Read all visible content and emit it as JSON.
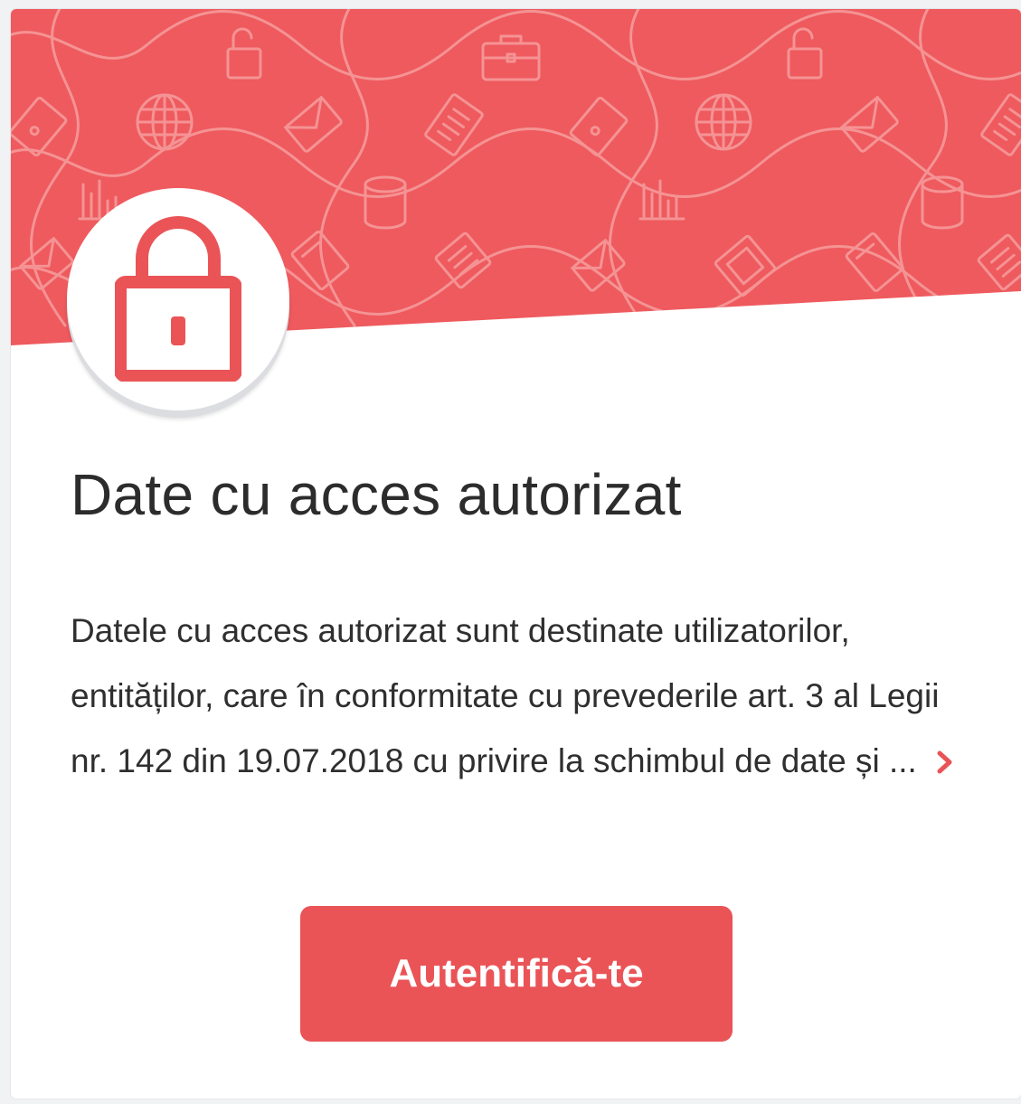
{
  "card": {
    "title": "Date cu acces autorizat",
    "description": "Datele cu acces autorizat sunt destinate utilizatorilor, entităților, care în conformitate cu prevederile art. 3 al Legii nr. 142 din 19.07.2018 cu privire la schimbul de date și ...",
    "more_icon": "chevron-right-icon",
    "lock_icon": "padlock-icon",
    "login_label": "Autentifică-te"
  },
  "colors": {
    "accent": "#ea5457",
    "banner": "#ee5a5e",
    "pattern": "#f7a2a2",
    "title_text": "#2c2c2c",
    "body_text": "#2f2f2f",
    "page_background": "#f1f2f4"
  }
}
